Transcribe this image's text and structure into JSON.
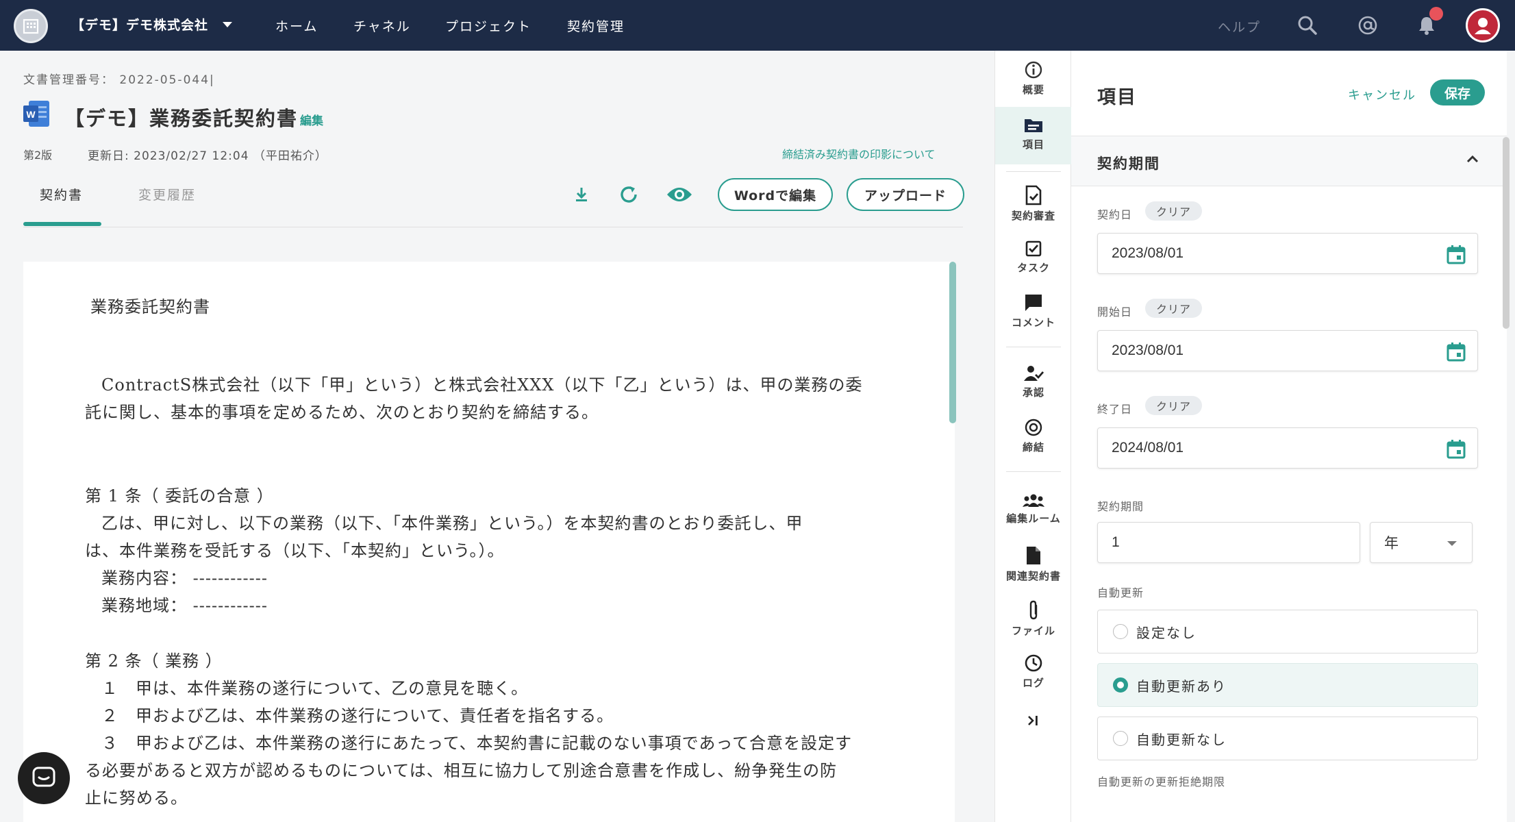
{
  "header": {
    "company_name": "【デモ】デモ株式会社",
    "nav": [
      "ホーム",
      "チャネル",
      "プロジェクト",
      "契約管理"
    ],
    "help": "ヘルプ"
  },
  "document": {
    "number_label": "文書管理番号：",
    "number_value": "2022-05-044",
    "title": "【デモ】業務委託契約書",
    "edit_link": "編集",
    "version": "第2版",
    "updated": "更新日: 2023/02/27 12:04 （平田祐介）",
    "seal_link": "締結済み契約書の印影について",
    "tabs": [
      "契約書",
      "変更履歴"
    ],
    "word_edit_button": "Wordで編集",
    "upload_button": "アップロード"
  },
  "contract_text": {
    "heading": "業務委託契約書",
    "intro_1": "ContractS株式会社（以下「甲」という）と株式会社XXX（以下「乙」という）は、甲の業務の委",
    "intro_2": "託に関し、基本的事項を定めるため、次のとおり契約を締結する。",
    "art1_title": "第 1 条（ 委託の合意 ）",
    "art1_l1": "乙は、甲に対し、以下の業務（以下、「本件業務」という。）を本契約書のとおり委託し、甲",
    "art1_l2": "は、本件業務を受託する（以下、「本契約」という。）。",
    "art1_l3": "業務内容：  ------------",
    "art1_l4": "業務地域：  ------------",
    "art2_title": "第 2 条（ 業務 ）",
    "art2_l1": "１　甲は、本件業務の遂行について、乙の意見を聴く。",
    "art2_l2": "２　甲および乙は、本件業務の遂行について、責任者を指名する。",
    "art2_l3": "３　甲および乙は、本件業務の遂行にあたって、本契約書に記載のない事項であって合意を設定す",
    "art2_l4": "る必要があると双方が認めるものについては、相互に協力して別途合意書を作成し、紛争発生の防",
    "art2_l5": "止に努める。"
  },
  "rail": {
    "items": [
      "概要",
      "項目",
      "契約審査",
      "タスク",
      "コメント",
      "承認",
      "締結",
      "編集ルーム",
      "関連契約書",
      "ファイル",
      "ログ"
    ]
  },
  "panel": {
    "title": "項目",
    "cancel": "キャンセル",
    "save": "保存",
    "section": "契約期間",
    "clear": "クリア",
    "contract_date_label": "契約日",
    "contract_date": "2023/08/01",
    "start_date_label": "開始日",
    "start_date": "2023/08/01",
    "end_date_label": "終了日",
    "end_date": "2024/08/01",
    "period_label": "契約期間",
    "period_value": "1",
    "period_unit": "年",
    "auto_renew_label": "自動更新",
    "auto_renew_options": [
      "設定なし",
      "自動更新あり",
      "自動更新なし"
    ],
    "auto_renew_selected": 1,
    "refusal_deadline_label": "自動更新の更新拒絶期限"
  },
  "colors": {
    "nav_bg": "#1d2b46",
    "accent": "#2a9d8f",
    "notification": "#e8535b"
  },
  "icons": [
    "building-icon",
    "caret-down-icon",
    "search-icon",
    "at-icon",
    "bell-icon",
    "user-avatar-icon",
    "word-file-icon",
    "download-icon",
    "refresh-icon",
    "eye-icon",
    "chat-icon",
    "info-icon",
    "folder-icon",
    "review-doc-icon",
    "task-check-icon",
    "comment-icon",
    "approve-user-icon",
    "target-icon",
    "group-icon",
    "document-icon",
    "paperclip-icon",
    "clock-icon",
    "collapse-icon",
    "calendar-icon",
    "chevron-up-icon"
  ]
}
